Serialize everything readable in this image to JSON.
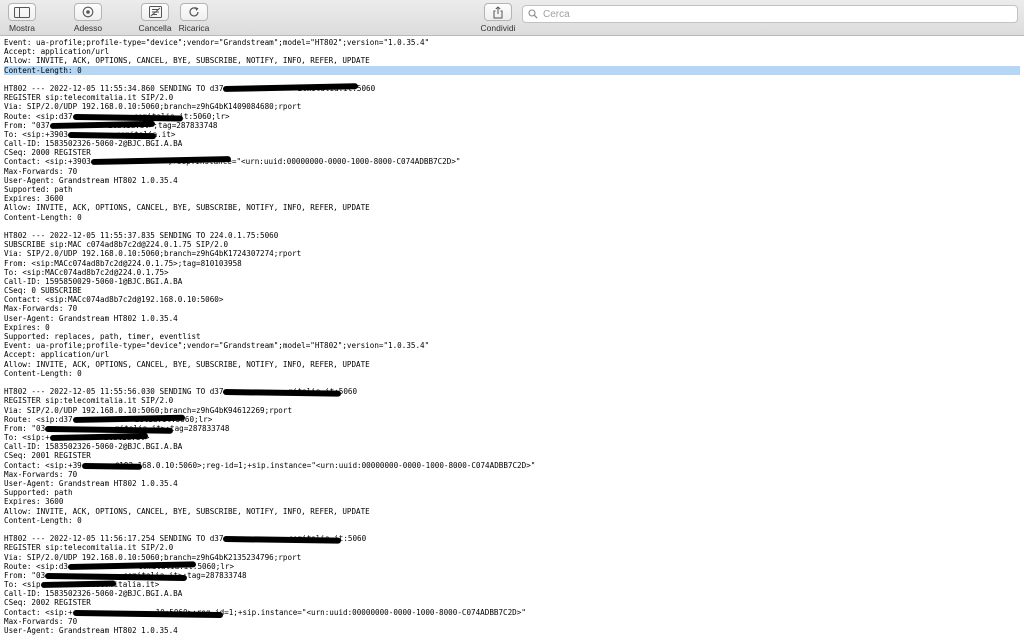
{
  "toolbar": {
    "show": "Mostra",
    "now": "Adesso",
    "clear": "Cancella",
    "reload": "Ricarica",
    "share": "Condividi",
    "search_placeholder": "Cerca"
  },
  "log_lines": [
    "Event: ua-profile;profile-type=\"device\";vendor=\"Grandstream\";model=\"HT802\";version=\"1.0.35.4\"",
    "Accept: application/url",
    "Allow: INVITE, ACK, OPTIONS, CANCEL, BYE, SUBSCRIBE, NOTIFY, INFO, REFER, UPDATE",
    "Content-Length: 0",
    "",
    "HT802 --- 2022-12-05 11:55:34.860 SENDING TO d37",
    "REGISTER sip:telecomitalia.it SIP/2.0",
    "Via: SIP/2.0/UDP 192.168.0.10:5060;branch=z9hG4bK1409084680;rport",
    "Route: <sip:d37",
    "From: \"037",
    "To: <sip:+3903",
    "Call-ID: 1583502326-5060-2@BJC.BGI.A.BA",
    "CSeq: 2000 REGISTER",
    "Contact: <sip:+3903",
    "Max-Forwards: 70",
    "User-Agent: Grandstream HT802 1.0.35.4",
    "Supported: path",
    "Expires: 3600",
    "Allow: INVITE, ACK, OPTIONS, CANCEL, BYE, SUBSCRIBE, NOTIFY, INFO, REFER, UPDATE",
    "Content-Length: 0",
    "",
    "HT802 --- 2022-12-05 11:55:37.835 SENDING TO 224.0.1.75:5060",
    "SUBSCRIBE sip:MAC c074ad8b7c2d@224.0.1.75 SIP/2.0",
    "Via: SIP/2.0/UDP 192.168.0.10:5060;branch=z9hG4bK1724307274;rport",
    "From: <sip:MACc074ad8b7c2d@224.0.1.75>;tag=810103958",
    "To: <sip:MACc074ad8b7c2d@224.0.1.75>",
    "Call-ID: 1595850029-5060-1@BJC.BGI.A.BA",
    "CSeq: 0 SUBSCRIBE",
    "Contact: <sip:MACc074ad8b7c2d@192.168.0.10:5060>",
    "Max-Forwards: 70",
    "User-Agent: Grandstream HT802 1.0.35.4",
    "Expires: 0",
    "Supported: replaces, path, timer, eventlist",
    "Event: ua-profile;profile-type=\"device\";vendor=\"Grandstream\";model=\"HT802\";version=\"1.0.35.4\"",
    "Accept: application/url",
    "Allow: INVITE, ACK, OPTIONS, CANCEL, BYE, SUBSCRIBE, NOTIFY, INFO, REFER, UPDATE",
    "Content-Length: 0",
    "",
    "HT802 --- 2022-12-05 11:55:56.030 SENDING TO d37",
    "REGISTER sip:telecomitalia.it SIP/2.0",
    "Via: SIP/2.0/UDP 192.168.0.10:5060;branch=z9hG4bK94612269;rport",
    "Route: <sip:d37",
    "From: \"03",
    "To: <sip:+",
    "Call-ID: 1583502326-5060-2@BJC.BGI.A.BA",
    "CSeq: 2001 REGISTER",
    "Contact: <sip:+39",
    "Max-Forwards: 70",
    "User-Agent: Grandstream HT802 1.0.35.4",
    "Supported: path",
    "Expires: 3600",
    "Allow: INVITE, ACK, OPTIONS, CANCEL, BYE, SUBSCRIBE, NOTIFY, INFO, REFER, UPDATE",
    "Content-Length: 0",
    "",
    "HT802 --- 2022-12-05 11:56:17.254 SENDING TO d37",
    "REGISTER sip:telecomitalia.it SIP/2.0",
    "Via: SIP/2.0/UDP 192.168.0.10:5060;branch=z9hG4bK2135234796;rport",
    "Route: <sip:d3",
    "From: \"03",
    "To: <sip",
    "Call-ID: 1583502326-5060-2@BJC.BGI.A.BA",
    "CSeq: 2002 REGISTER",
    "Contact: <sip:+",
    "Max-Forwards: 70",
    "User-Agent: Grandstream HT802 1.0.35.4"
  ],
  "redacted_tails": {
    "5": "itmitalia.it:5060",
    "8": "comitalia.it:5060;lr>",
    "9": "italia.it>;tag=287833748",
    "10": "comitalia.it>",
    "13": ";+sip.instance=\"<urn:uuid:00000000-0000-1000-8000-C074ADBB7C2D>\"",
    "38": "mitalia.it:5060",
    "41": "ialia.it:5060;lr>",
    "42": "mitalia.it>;tag=287833748",
    "43": "italia.it>",
    "46": "@192.168.0.10:5060>;reg-id=1;+sip.instance=\"<urn:uuid:00000000-0000-1000-8000-C074ADBB7C2D>\"",
    "54": "comitalia.it:5060",
    "57": "comitalia.it:5060;lr>",
    "58": "comitalia.it>;tag=287833748",
    "59": "telecomitalia.it>",
    "62": "10:5060>;reg-id=1;+sip.instance=\"<urn:uuid:00000000-0000-1000-8000-C074ADBB7C2D>\""
  },
  "selected_line_index": 3
}
